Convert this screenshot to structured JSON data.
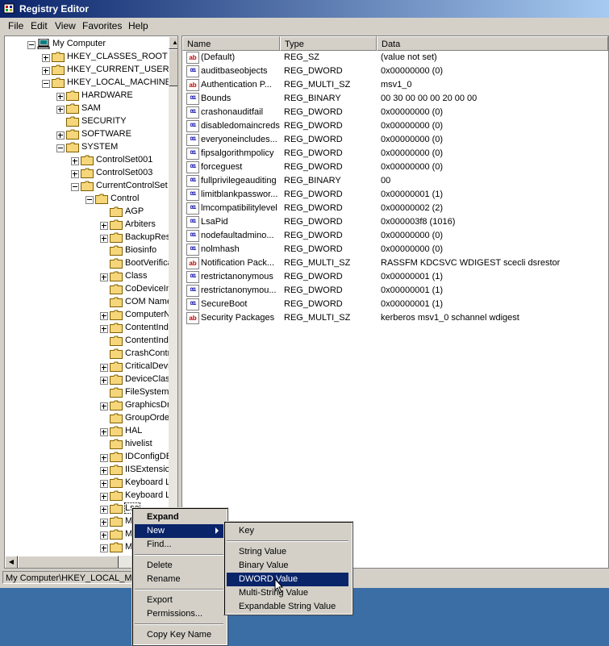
{
  "window": {
    "title": "Registry Editor",
    "icon": "registry-icon"
  },
  "menubar": [
    "File",
    "Edit",
    "View",
    "Favorites",
    "Help"
  ],
  "tree": [
    {
      "label": "My Computer",
      "level": 0,
      "expander": "minus",
      "icon": "computer-icon"
    },
    {
      "label": "HKEY_CLASSES_ROOT",
      "level": 1,
      "expander": "plus"
    },
    {
      "label": "HKEY_CURRENT_USER",
      "level": 1,
      "expander": "plus"
    },
    {
      "label": "HKEY_LOCAL_MACHINE",
      "level": 1,
      "expander": "minus"
    },
    {
      "label": "HARDWARE",
      "level": 2,
      "expander": "plus"
    },
    {
      "label": "SAM",
      "level": 2,
      "expander": "plus"
    },
    {
      "label": "SECURITY",
      "level": 2,
      "expander": "none"
    },
    {
      "label": "SOFTWARE",
      "level": 2,
      "expander": "plus"
    },
    {
      "label": "SYSTEM",
      "level": 2,
      "expander": "minus"
    },
    {
      "label": "ControlSet001",
      "level": 3,
      "expander": "plus"
    },
    {
      "label": "ControlSet003",
      "level": 3,
      "expander": "plus"
    },
    {
      "label": "CurrentControlSet",
      "level": 3,
      "expander": "minus"
    },
    {
      "label": "Control",
      "level": 4,
      "expander": "minus"
    },
    {
      "label": "AGP",
      "level": 5,
      "expander": "none"
    },
    {
      "label": "Arbiters",
      "level": 5,
      "expander": "plus"
    },
    {
      "label": "BackupResto",
      "level": 5,
      "expander": "plus"
    },
    {
      "label": "Biosinfo",
      "level": 5,
      "expander": "none"
    },
    {
      "label": "BootVerificat",
      "level": 5,
      "expander": "none"
    },
    {
      "label": "Class",
      "level": 5,
      "expander": "plus"
    },
    {
      "label": "CoDeviceIns",
      "level": 5,
      "expander": "none"
    },
    {
      "label": "COM Name A",
      "level": 5,
      "expander": "none"
    },
    {
      "label": "ComputerNa",
      "level": 5,
      "expander": "plus"
    },
    {
      "label": "ContentInde",
      "level": 5,
      "expander": "plus"
    },
    {
      "label": "ContentInde",
      "level": 5,
      "expander": "none"
    },
    {
      "label": "CrashContro",
      "level": 5,
      "expander": "none"
    },
    {
      "label": "CriticalDevic",
      "level": 5,
      "expander": "plus"
    },
    {
      "label": "DeviceClass",
      "level": 5,
      "expander": "plus"
    },
    {
      "label": "FileSystem",
      "level": 5,
      "expander": "none"
    },
    {
      "label": "GraphicsDriv",
      "level": 5,
      "expander": "plus"
    },
    {
      "label": "GroupOrderl",
      "level": 5,
      "expander": "none"
    },
    {
      "label": "HAL",
      "level": 5,
      "expander": "plus"
    },
    {
      "label": "hivelist",
      "level": 5,
      "expander": "none"
    },
    {
      "label": "IDConfigDB",
      "level": 5,
      "expander": "plus"
    },
    {
      "label": "IISExtension",
      "level": 5,
      "expander": "plus"
    },
    {
      "label": "Keyboard La",
      "level": 5,
      "expander": "plus"
    },
    {
      "label": "Keyboard La",
      "level": 5,
      "expander": "plus"
    },
    {
      "label": "Lsa",
      "level": 5,
      "expander": "plus",
      "selected": true
    },
    {
      "label": "Med",
      "level": 5,
      "expander": "plus"
    },
    {
      "label": "Med",
      "level": 5,
      "expander": "plus"
    },
    {
      "label": "Med",
      "level": 5,
      "expander": "plus"
    }
  ],
  "columns": [
    "Name",
    "Type",
    "Data"
  ],
  "values": [
    {
      "name": "(Default)",
      "type": "REG_SZ",
      "data": "(value not set)",
      "icon": "string-value-icon"
    },
    {
      "name": "auditbaseobjects",
      "type": "REG_DWORD",
      "data": "0x00000000 (0)",
      "icon": "binary-value-icon"
    },
    {
      "name": "Authentication P...",
      "type": "REG_MULTI_SZ",
      "data": "msv1_0",
      "icon": "string-value-icon"
    },
    {
      "name": "Bounds",
      "type": "REG_BINARY",
      "data": "00 30 00 00 00 20 00 00",
      "icon": "binary-value-icon"
    },
    {
      "name": "crashonauditfail",
      "type": "REG_DWORD",
      "data": "0x00000000 (0)",
      "icon": "binary-value-icon"
    },
    {
      "name": "disabledomaincreds",
      "type": "REG_DWORD",
      "data": "0x00000000 (0)",
      "icon": "binary-value-icon"
    },
    {
      "name": "everyoneincludes...",
      "type": "REG_DWORD",
      "data": "0x00000000 (0)",
      "icon": "binary-value-icon"
    },
    {
      "name": "fipsalgorithmpolicy",
      "type": "REG_DWORD",
      "data": "0x00000000 (0)",
      "icon": "binary-value-icon"
    },
    {
      "name": "forceguest",
      "type": "REG_DWORD",
      "data": "0x00000000 (0)",
      "icon": "binary-value-icon"
    },
    {
      "name": "fullprivilegeauditing",
      "type": "REG_BINARY",
      "data": "00",
      "icon": "binary-value-icon"
    },
    {
      "name": "limitblankpasswor...",
      "type": "REG_DWORD",
      "data": "0x00000001 (1)",
      "icon": "binary-value-icon"
    },
    {
      "name": "lmcompatibilitylevel",
      "type": "REG_DWORD",
      "data": "0x00000002 (2)",
      "icon": "binary-value-icon"
    },
    {
      "name": "LsaPid",
      "type": "REG_DWORD",
      "data": "0x000003f8 (1016)",
      "icon": "binary-value-icon"
    },
    {
      "name": "nodefaultadmino...",
      "type": "REG_DWORD",
      "data": "0x00000000 (0)",
      "icon": "binary-value-icon"
    },
    {
      "name": "nolmhash",
      "type": "REG_DWORD",
      "data": "0x00000000 (0)",
      "icon": "binary-value-icon"
    },
    {
      "name": "Notification Pack...",
      "type": "REG_MULTI_SZ",
      "data": "RASSFM KDCSVC WDIGEST scecli dsrestor",
      "icon": "string-value-icon"
    },
    {
      "name": "restrictanonymous",
      "type": "REG_DWORD",
      "data": "0x00000001 (1)",
      "icon": "binary-value-icon"
    },
    {
      "name": "restrictanonymou...",
      "type": "REG_DWORD",
      "data": "0x00000001 (1)",
      "icon": "binary-value-icon"
    },
    {
      "name": "SecureBoot",
      "type": "REG_DWORD",
      "data": "0x00000001 (1)",
      "icon": "binary-value-icon"
    },
    {
      "name": "Security Packages",
      "type": "REG_MULTI_SZ",
      "data": "kerberos msv1_0 schannel wdigest",
      "icon": "string-value-icon"
    }
  ],
  "status": "My Computer\\HKEY_LOCAL_MACHINE\\SYSTEM\\CurrentControlSet\\Control\\Lsa",
  "context_menu": [
    {
      "label": "Expand",
      "bold": true
    },
    {
      "label": "New",
      "submenu": true,
      "highlighted": true
    },
    {
      "label": "Find..."
    },
    {
      "sep": true
    },
    {
      "label": "Delete"
    },
    {
      "label": "Rename"
    },
    {
      "sep": true
    },
    {
      "label": "Export"
    },
    {
      "label": "Permissions..."
    },
    {
      "sep": true
    },
    {
      "label": "Copy Key Name"
    }
  ],
  "submenu": [
    {
      "label": "Key"
    },
    {
      "sep": true
    },
    {
      "label": "String Value"
    },
    {
      "label": "Binary Value"
    },
    {
      "label": "DWORD Value",
      "highlighted": true
    },
    {
      "label": "Multi-String Value"
    },
    {
      "label": "Expandable String Value"
    }
  ],
  "colors": {
    "highlight": "#0a246a",
    "desktop": "#3a6ea5",
    "face": "#d4d0c8",
    "folder": "#f5d67a"
  }
}
